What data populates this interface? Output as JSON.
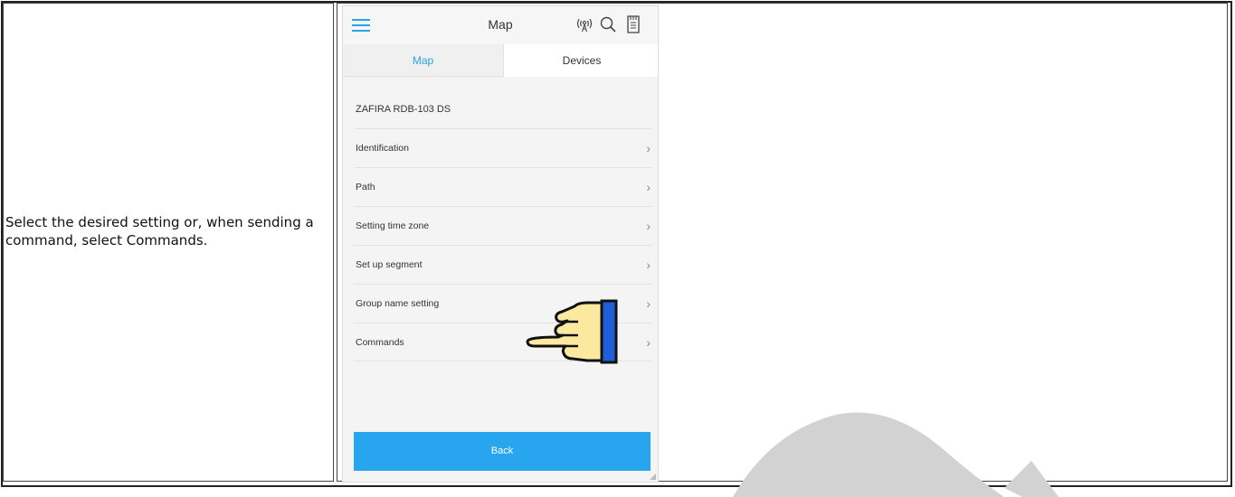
{
  "instruction": "Select the desired setting or, when sending a command, select Commands.",
  "app": {
    "title": "Map",
    "tabs": [
      {
        "label": "Map",
        "active": true
      },
      {
        "label": "Devices",
        "active": false
      }
    ],
    "device_name": "ZAFIRA RDB-103 DS",
    "menu_items": [
      {
        "label": "Identification"
      },
      {
        "label": "Path"
      },
      {
        "label": "Setting time zone"
      },
      {
        "label": "Set up segment"
      },
      {
        "label": "Group name setting"
      },
      {
        "label": "Commands"
      }
    ],
    "back_label": "Back",
    "icons": [
      "menu-icon",
      "antenna-icon",
      "search-icon",
      "sd-card-icon",
      "chevron-right-icon",
      "pointing-hand-icon"
    ]
  },
  "colors": {
    "accent": "#2aa3e6",
    "button": "#27a5ef",
    "hand": "#fce9a0",
    "hand_cuff": "#1f5fd6"
  }
}
